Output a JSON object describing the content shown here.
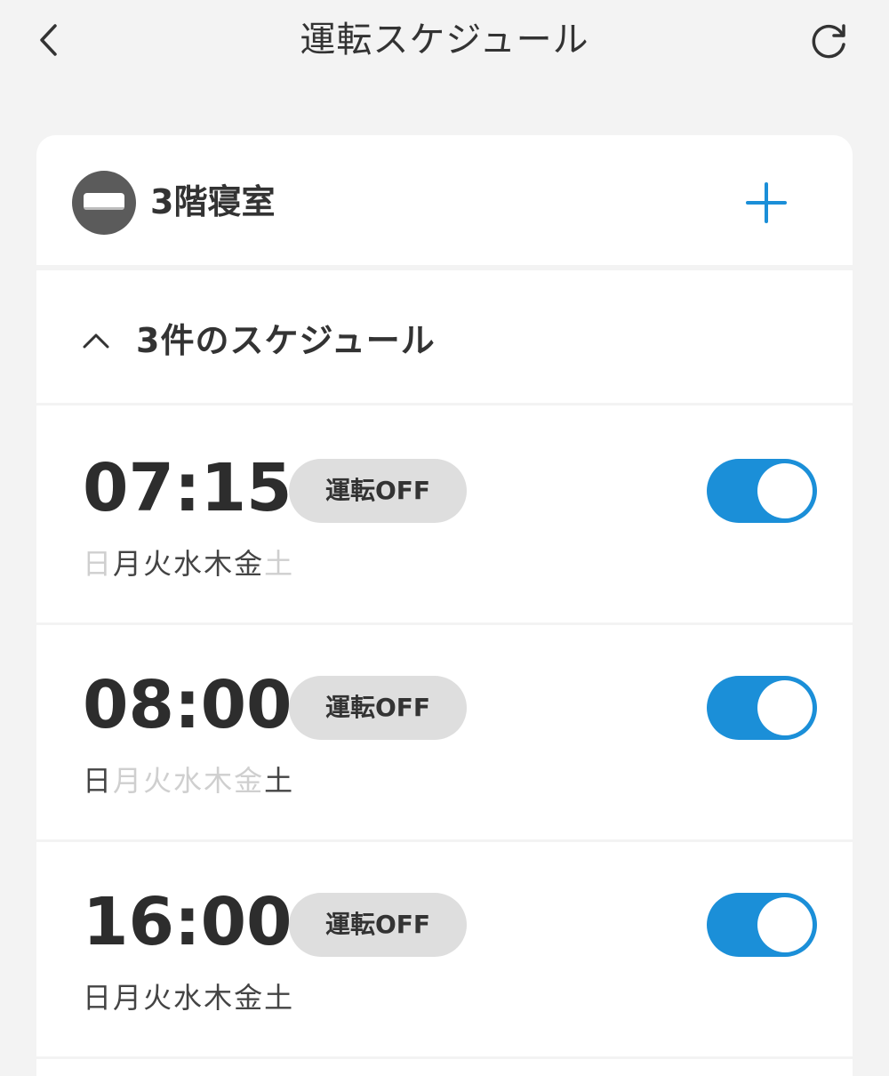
{
  "header": {
    "title": "運転スケジュール",
    "back_icon": "chevron-left-icon",
    "refresh_icon": "refresh-icon"
  },
  "device": {
    "name": "3階寝室",
    "icon": "air-conditioner-icon",
    "add_icon": "plus-icon"
  },
  "schedule_section": {
    "title": "3件のスケジュール",
    "collapse_icon": "chevron-up-icon"
  },
  "colors": {
    "accent": "#1b8fd8",
    "background": "#f3f3f3",
    "badge": "#dedede",
    "inactive_day": "#cfcfcf"
  },
  "schedules": [
    {
      "time": "07:15",
      "action": "運転OFF",
      "enabled": true,
      "days": [
        {
          "label": "日",
          "active": false
        },
        {
          "label": "月",
          "active": true
        },
        {
          "label": "火",
          "active": true
        },
        {
          "label": "水",
          "active": true
        },
        {
          "label": "木",
          "active": true
        },
        {
          "label": "金",
          "active": true
        },
        {
          "label": "土",
          "active": false
        }
      ]
    },
    {
      "time": "08:00",
      "action": "運転OFF",
      "enabled": true,
      "days": [
        {
          "label": "日",
          "active": true
        },
        {
          "label": "月",
          "active": false
        },
        {
          "label": "火",
          "active": false
        },
        {
          "label": "水",
          "active": false
        },
        {
          "label": "木",
          "active": false
        },
        {
          "label": "金",
          "active": false
        },
        {
          "label": "土",
          "active": true
        }
      ]
    },
    {
      "time": "16:00",
      "action": "運転OFF",
      "enabled": true,
      "days": [
        {
          "label": "日",
          "active": true
        },
        {
          "label": "月",
          "active": true
        },
        {
          "label": "火",
          "active": true
        },
        {
          "label": "水",
          "active": true
        },
        {
          "label": "木",
          "active": true
        },
        {
          "label": "金",
          "active": true
        },
        {
          "label": "土",
          "active": true
        }
      ]
    }
  ]
}
